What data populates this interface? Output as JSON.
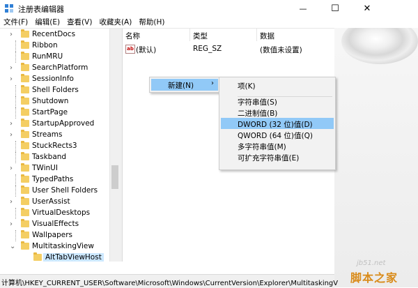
{
  "window": {
    "title": "注册表编辑器",
    "minimize_glyph": "—",
    "maximize_glyph": "☐",
    "close_glyph": "✕"
  },
  "menubar": [
    "文件(F)",
    "编辑(E)",
    "查看(V)",
    "收藏夹(A)",
    "帮助(H)"
  ],
  "tree": {
    "items": [
      {
        "label": "RecentDocs",
        "chevron": "›"
      },
      {
        "label": "Ribbon",
        "chevron": ""
      },
      {
        "label": "RunMRU",
        "chevron": ""
      },
      {
        "label": "SearchPlatform",
        "chevron": "›"
      },
      {
        "label": "SessionInfo",
        "chevron": "›"
      },
      {
        "label": "Shell Folders",
        "chevron": ""
      },
      {
        "label": "Shutdown",
        "chevron": ""
      },
      {
        "label": "StartPage",
        "chevron": ""
      },
      {
        "label": "StartupApproved",
        "chevron": "›"
      },
      {
        "label": "Streams",
        "chevron": "›"
      },
      {
        "label": "StuckRects3",
        "chevron": ""
      },
      {
        "label": "Taskband",
        "chevron": ""
      },
      {
        "label": "TWinUI",
        "chevron": "›"
      },
      {
        "label": "TypedPaths",
        "chevron": ""
      },
      {
        "label": "User Shell Folders",
        "chevron": ""
      },
      {
        "label": "UserAssist",
        "chevron": "›"
      },
      {
        "label": "VirtualDesktops",
        "chevron": ""
      },
      {
        "label": "VisualEffects",
        "chevron": "›"
      },
      {
        "label": "Wallpapers",
        "chevron": ""
      },
      {
        "label": "MultitaskingView",
        "chevron": "⌄"
      }
    ],
    "child": {
      "label": "AltTabViewHost"
    }
  },
  "list": {
    "headers": {
      "name": "名称",
      "type": "类型",
      "data": "数据"
    },
    "rows": [
      {
        "icon": "ab",
        "name": "(默认)",
        "type": "REG_SZ",
        "data": "(数值未设置)"
      }
    ]
  },
  "context_menu": {
    "parent": {
      "label": "新建(N)",
      "arrow": "›"
    },
    "submenu": [
      {
        "label": "项(K)",
        "highlight": false
      },
      {
        "label": "字符串值(S)",
        "highlight": false
      },
      {
        "label": "二进制值(B)",
        "highlight": false
      },
      {
        "label": "DWORD (32 位)值(D)",
        "highlight": true
      },
      {
        "label": "QWORD (64 位)值(Q)",
        "highlight": false
      },
      {
        "label": "多字符串值(M)",
        "highlight": false
      },
      {
        "label": "可扩充字符串值(E)",
        "highlight": false
      }
    ]
  },
  "statusbar": {
    "path": "计算机\\HKEY_CURRENT_USER\\Software\\Microsoft\\Windows\\CurrentVersion\\Explorer\\MultitaskingV"
  },
  "watermark": {
    "site": "jb51.net",
    "logo": "脚本之家"
  },
  "colors": {
    "selection": "#91c9f7",
    "folder": "#f4ce63",
    "watermark": "#d98b1a"
  }
}
